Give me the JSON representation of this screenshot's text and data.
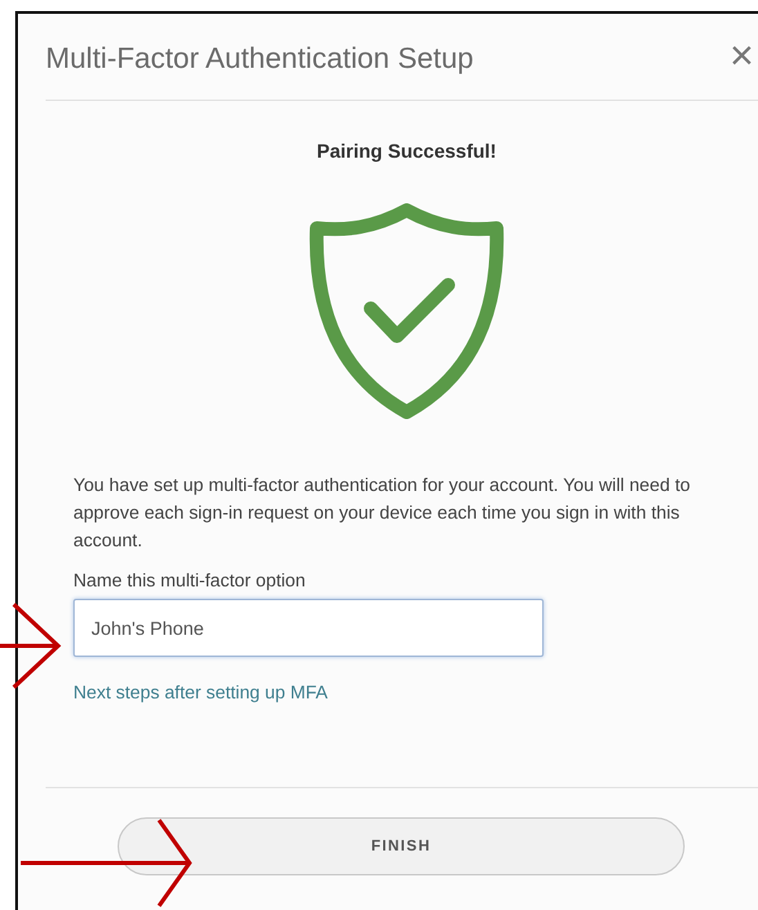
{
  "dialog": {
    "title": "Multi-Factor Authentication Setup",
    "close_label": "×",
    "heading": "Pairing Successful!",
    "message": "You have set up multi-factor authentication for your account. You will need to approve each sign-in request on your device each time you sign in with this account.",
    "name_field": {
      "label": "Name this multi-factor option",
      "value": "John's Phone",
      "focused": true
    },
    "link": "Next steps after setting up MFA",
    "buttons": [
      {
        "label": "FINISH"
      }
    ]
  }
}
